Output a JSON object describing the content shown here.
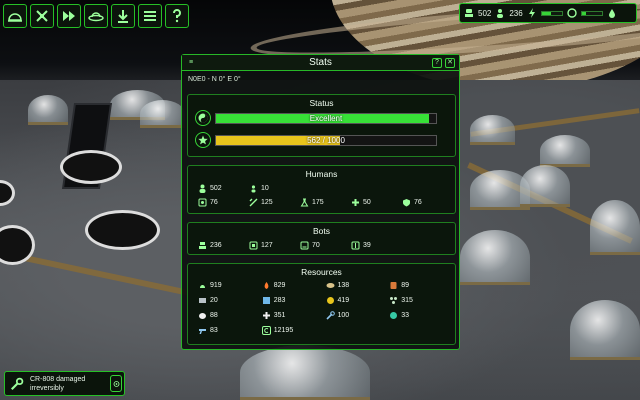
{
  "toolbar": {
    "buttons": [
      {
        "icon": "dome-view-icon"
      },
      {
        "icon": "build-tools-icon"
      },
      {
        "icon": "fast-forward-icon"
      },
      {
        "icon": "ufo-icon"
      },
      {
        "icon": "download-icon"
      },
      {
        "icon": "menu-icon"
      },
      {
        "icon": "help-icon"
      }
    ]
  },
  "topbar": {
    "bots": "502",
    "humans": "236",
    "power_level": 0.45,
    "oxygen_level": 0.2
  },
  "panel": {
    "title": "Stats",
    "coords": "N0E0 - N 0° E 0°",
    "status": {
      "heading": "Status",
      "mood_label": "Excellent",
      "mood_level": 0.97,
      "capacity_label": "562 / 1000",
      "capacity_level": 0.562
    },
    "humans": {
      "heading": "Humans",
      "values": [
        "502",
        "10",
        "76",
        "125",
        "175",
        "50",
        "76"
      ]
    },
    "bots": {
      "heading": "Bots",
      "values": [
        "236",
        "127",
        "70",
        "39"
      ]
    },
    "resources": {
      "heading": "Resources",
      "values": [
        "919",
        "829",
        "138",
        "89",
        "20",
        "283",
        "419",
        "315",
        "88",
        "351",
        "100",
        "33",
        "83",
        "12195"
      ]
    }
  },
  "notification": {
    "text": "CR-808 damaged irreversibly"
  },
  "colors": {
    "accent": "#27b827",
    "mood_fill": "#37e037",
    "capacity_fill": "#e8c51c"
  }
}
